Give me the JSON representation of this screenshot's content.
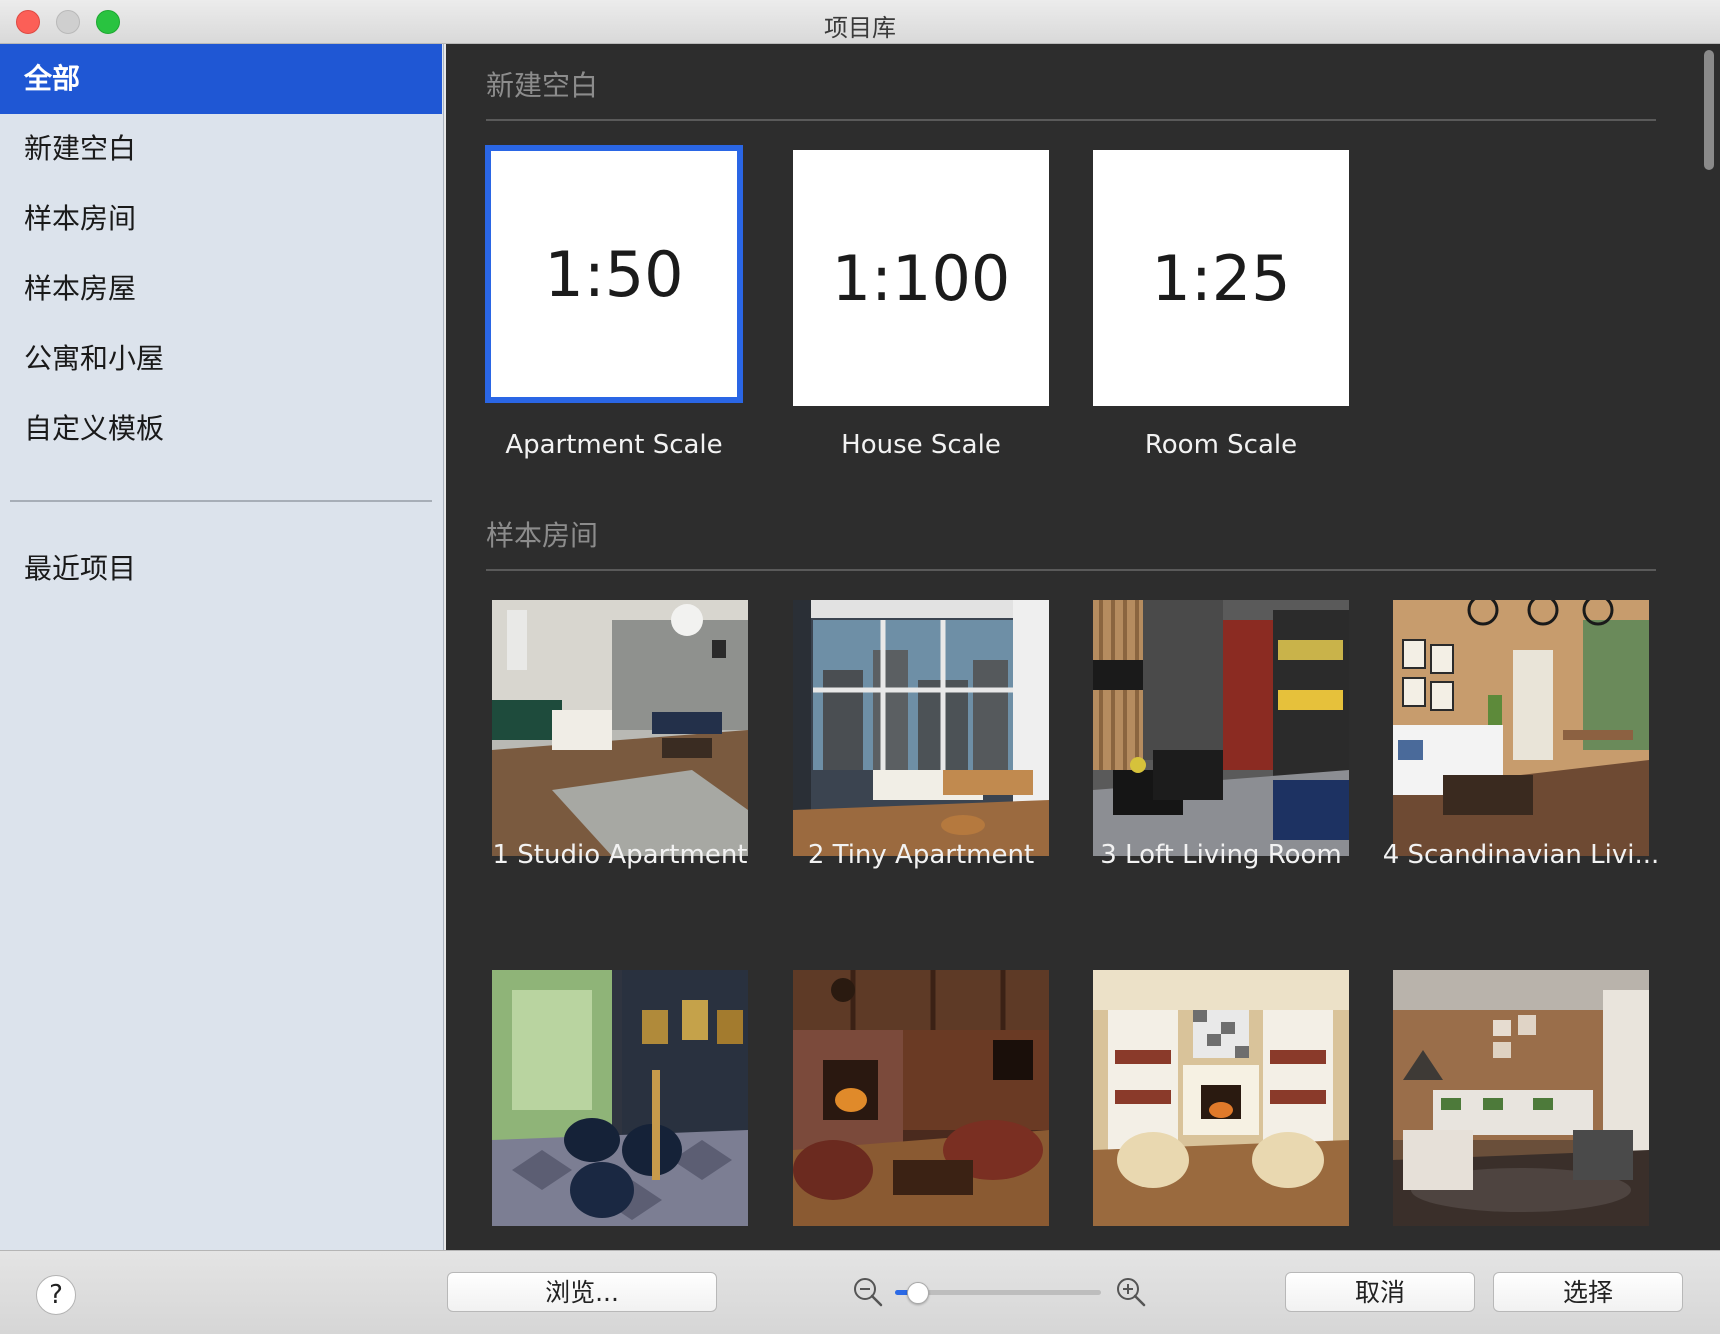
{
  "window": {
    "title": "项目库"
  },
  "sidebar": {
    "items": [
      {
        "label": "全部",
        "selected": true
      },
      {
        "label": "新建空白"
      },
      {
        "label": "样本房间"
      },
      {
        "label": "样本房屋"
      },
      {
        "label": "公寓和小屋"
      },
      {
        "label": "自定义模板"
      }
    ],
    "recent": {
      "label": "最近项目"
    }
  },
  "main": {
    "sections": [
      {
        "title": "新建空白",
        "cards": [
          {
            "scale": "1:50",
            "label": "Apartment Scale",
            "selected": true
          },
          {
            "scale": "1:100",
            "label": "House Scale"
          },
          {
            "scale": "1:25",
            "label": "Room Scale"
          }
        ]
      },
      {
        "title": "样本房间",
        "cards": [
          {
            "label": "1 Studio Apartment"
          },
          {
            "label": "2 Tiny Apartment"
          },
          {
            "label": "3 Loft Living Room"
          },
          {
            "label": "4 Scandinavian Livi..."
          }
        ]
      }
    ]
  },
  "footer": {
    "help": "?",
    "browse": "浏览...",
    "cancel": "取消",
    "select": "选择",
    "zoom": {
      "level": 0.1,
      "out_icon": "zoom-out-icon",
      "in_icon": "zoom-in-icon"
    }
  },
  "colors": {
    "accent": "#1f57d4",
    "selection_border": "#2a66e5",
    "content_bg": "#2d2d2d",
    "sidebar_bg": "#dce3ec"
  }
}
